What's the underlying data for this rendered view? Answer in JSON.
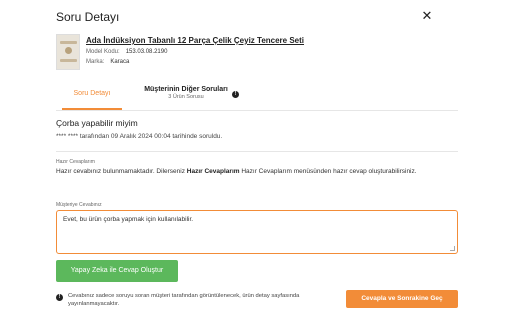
{
  "modal": {
    "title": "Soru Detayı",
    "close_glyph": "✕"
  },
  "product": {
    "name": "Ada İndüksiyon Tabanlı 12 Parça Çelik Çeyiz Tencere Seti",
    "code_label": "Model Kodu:",
    "code_value": "153.03.08.2190",
    "brand_label": "Marka:",
    "brand_value": "Karaca"
  },
  "tabs": {
    "active": {
      "label": "Soru Detayı"
    },
    "other": {
      "label": "Müşterinin Diğer Soruları",
      "sub": "3 Ürün Sorusu"
    }
  },
  "question": {
    "text": "Çorba yapabilir miyim",
    "meta": "**** **** tarafından 09 Aralık 2024 00:04 tarihinde soruldu."
  },
  "ready_answers": {
    "label": "Hazır Cevaplarım",
    "text_before": "Hazır cevabınız bulunmamaktadır. Dilerseniz ",
    "text_bold": "Hazır Cevaplarım",
    "text_after": " Hazır Cevaplarım menüsünden hazır cevap oluşturabilirsiniz."
  },
  "answer": {
    "label": "Müşteriye Cevabınız",
    "value": "Evet, bu ürün çorba yapmak için kullanılabilir."
  },
  "buttons": {
    "ai_generate": "Yapay Zeka ile Cevap Oluştur",
    "submit_next": "Cevapla ve Sonrakine Geç"
  },
  "notice": {
    "icon_glyph": "!",
    "text": "Cevabınız sadece soruyu soran müşteri tarafından görüntülenecek, ürün detay sayfasında yayınlanmayacaktır."
  },
  "icons": {
    "info_glyph": "!"
  },
  "colors": {
    "accent": "#f28c38",
    "ai_button": "#5cb85c"
  }
}
